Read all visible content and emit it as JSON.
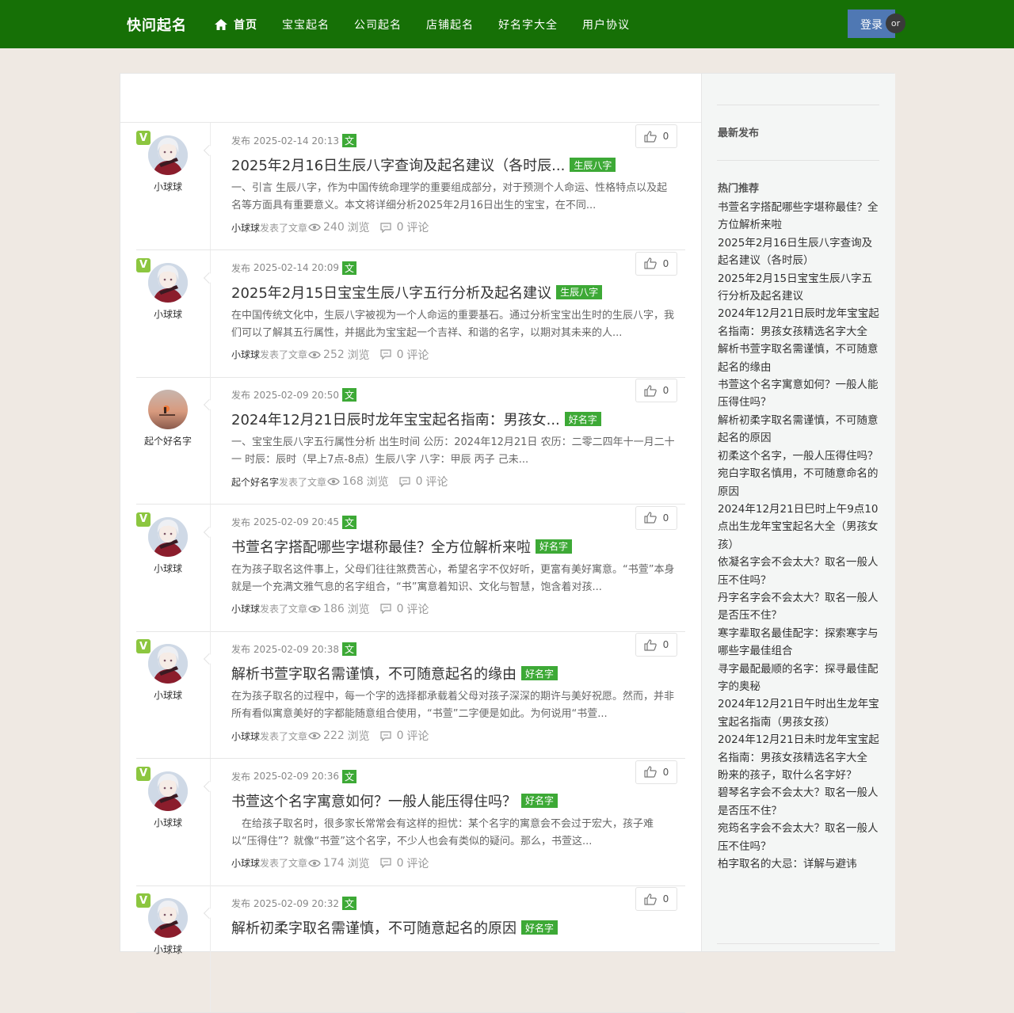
{
  "site": {
    "logo": "快问起名",
    "nav": [
      "首页",
      "宝宝起名",
      "公司起名",
      "店铺起名",
      "好名字大全",
      "用户协议"
    ],
    "login": "登录",
    "or": "or"
  },
  "labels": {
    "publish_prefix": "发布",
    "wen": "文",
    "published_article": "发表了文章",
    "views_suffix": "浏览",
    "comments_suffix": "评论"
  },
  "posts": [
    {
      "date": "2025-02-14 20:13",
      "title": "2025年2月16日生辰八字查询及起名建议（各时辰...",
      "tag": "生辰八字",
      "excerpt": "一、引言 生辰八字，作为中国传统命理学的重要组成部分，对于预测个人命运、性格特点以及起名等方面具有重要意义。本文将详细分析2025年2月16日出生的宝宝，在不同...",
      "author": "小球球",
      "views": "240",
      "comments": "0",
      "likes": "0",
      "verified": true,
      "avatar": "anime"
    },
    {
      "date": "2025-02-14 20:09",
      "title": "2025年2月15日宝宝生辰八字五行分析及起名建议",
      "tag": "生辰八字",
      "excerpt": "在中国传统文化中，生辰八字被视为一个人命运的重要基石。通过分析宝宝出生时的生辰八字，我们可以了解其五行属性，并据此为宝宝起一个吉祥、和谐的名字，以期对其未来的人...",
      "author": "小球球",
      "views": "252",
      "comments": "0",
      "likes": "0",
      "verified": true,
      "avatar": "anime"
    },
    {
      "date": "2025-02-09 20:50",
      "title": "2024年12月21日辰时龙年宝宝起名指南：男孩女...",
      "tag": "好名字",
      "excerpt": "一、宝宝生辰八字五行属性分析 出生时间 公历：2024年12月21日 农历：二零二四年十一月二十一 时辰：辰时（早上7点-8点）生辰八字 八字：甲辰 丙子 己未...",
      "author": "起个好名字",
      "views": "168",
      "comments": "0",
      "likes": "0",
      "verified": false,
      "avatar": "sunset"
    },
    {
      "date": "2025-02-09 20:45",
      "title": "书萱名字搭配哪些字堪称最佳？全方位解析来啦",
      "tag": "好名字",
      "excerpt": "在为孩子取名这件事上，父母们往往煞费苦心，希望名字不仅好听，更富有美好寓意。“书萱”本身就是一个充满文雅气息的名字组合，“书”寓意着知识、文化与智慧，饱含着对孩...",
      "author": "小球球",
      "views": "186",
      "comments": "0",
      "likes": "0",
      "verified": true,
      "avatar": "anime"
    },
    {
      "date": "2025-02-09 20:38",
      "title": "解析书萱字取名需谨慎，不可随意起名的缘由",
      "tag": "好名字",
      "excerpt": "在为孩子取名的过程中，每一个字的选择都承载着父母对孩子深深的期许与美好祝愿。然而，并非所有看似寓意美好的字都能随意组合使用，“书萱”二字便是如此。为何说用“书萱...",
      "author": "小球球",
      "views": "222",
      "comments": "0",
      "likes": "0",
      "verified": true,
      "avatar": "anime"
    },
    {
      "date": "2025-02-09 20:36",
      "title": "书萱这个名字寓意如何？一般人能压得住吗？",
      "tag": "好名字",
      "excerpt": "　在给孩子取名时，很多家长常常会有这样的担忧：某个名字的寓意会不会过于宏大，孩子难以“压得住”？就像“书萱”这个名字，不少人也会有类似的疑问。那么，书萱这...",
      "author": "小球球",
      "views": "174",
      "comments": "0",
      "likes": "0",
      "verified": true,
      "avatar": "anime"
    },
    {
      "date": "2025-02-09 20:32",
      "title": "解析初柔字取名需谨慎，不可随意起名的原因",
      "tag": "好名字",
      "excerpt": "",
      "author": "小球球",
      "views": "",
      "comments": "",
      "likes": "0",
      "verified": true,
      "avatar": "anime"
    }
  ],
  "sidebar": {
    "latest_title": "最新发布",
    "hot_title": "热门推荐",
    "hot_items": [
      "书萱名字搭配哪些字堪称最佳？全方位解析来啦",
      "2025年2月16日生辰八字查询及起名建议（各时辰）",
      "2025年2月15日宝宝生辰八字五行分析及起名建议",
      "2024年12月21日辰时龙年宝宝起名指南：男孩女孩精选名字大全",
      "解析书萱字取名需谨慎，不可随意起名的缘由",
      "书萱这个名字寓意如何？一般人能压得住吗？",
      "解析初柔字取名需谨慎，不可随意起名的原因",
      "初柔这个名字，一般人压得住吗？",
      "宛白字取名慎用，不可随意命名的原因",
      "2024年12月21日巳时上午9点10点出生龙年宝宝起名大全（男孩女孩）",
      "依凝名字会不会太大？取名一般人压不住吗？",
      "丹字名字会不会太大？取名一般人是否压不住？",
      "寒字辈取名最佳配字：探索寒字与哪些字最佳组合",
      "寻字最配最顺的名字：探寻最佳配字的奥秘",
      "2024年12月21日午时出生龙年宝宝起名指南（男孩女孩）",
      "2024年12月21日未时龙年宝宝起名指南：男孩女孩精选名字大全",
      "盼来的孩子，取什么名字好？",
      "碧琴名字会不会太大？取名一般人是否压不住？",
      "宛筠名字会不会太大？取名一般人压不住吗？",
      "柏字取名的大忌：详解与避讳"
    ]
  },
  "colors": {
    "header": "#167006",
    "accent": "#3da936",
    "badge": "#8cc63f",
    "login": "#4f78b3"
  }
}
